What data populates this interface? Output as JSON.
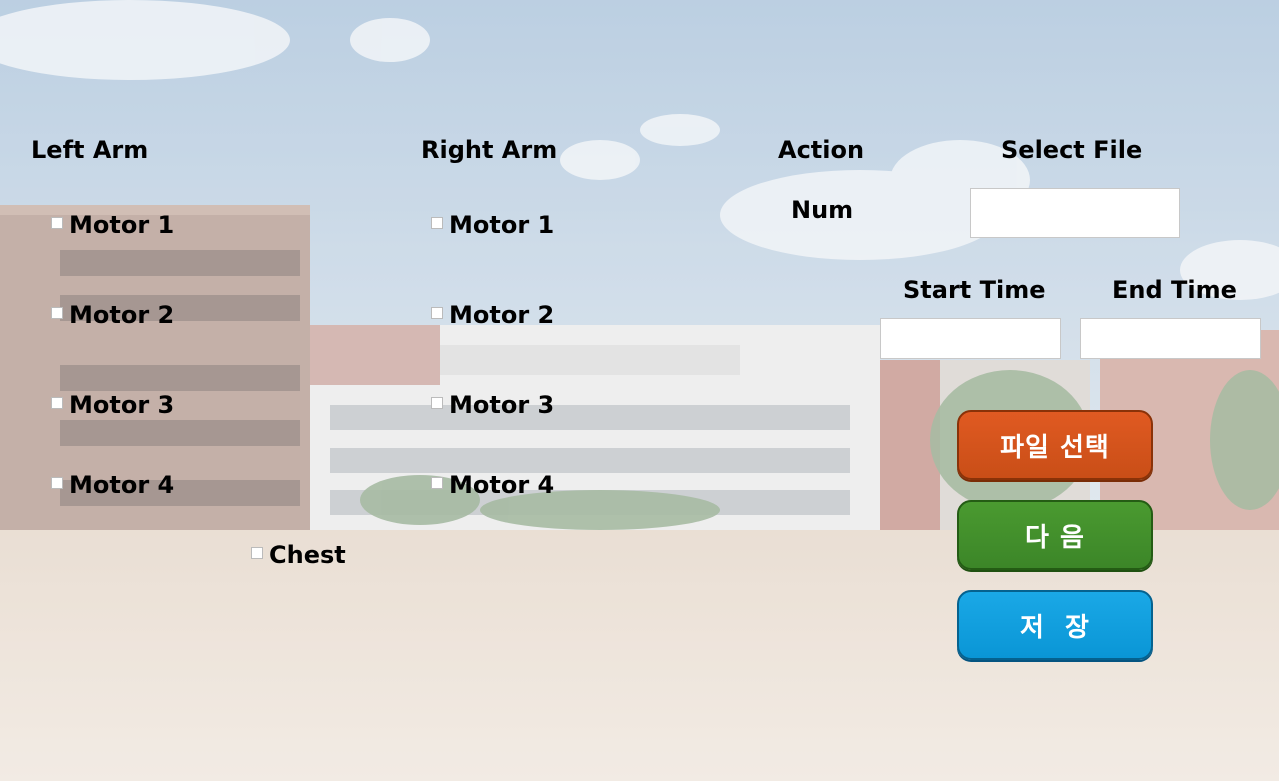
{
  "left_arm": {
    "heading": "Left Arm",
    "motors": [
      "Motor 1",
      "Motor 2",
      "Motor 3",
      "Motor 4"
    ],
    "chest": "Chest"
  },
  "right_arm": {
    "heading": "Right Arm",
    "motors": [
      "Motor 1",
      "Motor 2",
      "Motor 3",
      "Motor 4"
    ]
  },
  "action": {
    "heading": "Action",
    "num_label": "Num",
    "num_value": "",
    "select_file_label": "Select File",
    "start_time_label": "Start Time",
    "start_time_value": "",
    "end_time_label": "End Time",
    "end_time_value": ""
  },
  "buttons": {
    "select_file": "파일 선택",
    "next": "다 음",
    "save": "저  장"
  },
  "colors": {
    "select_file_button": "#d2541b",
    "next_button": "#3f8a2b",
    "save_button": "#0f9fdf"
  }
}
